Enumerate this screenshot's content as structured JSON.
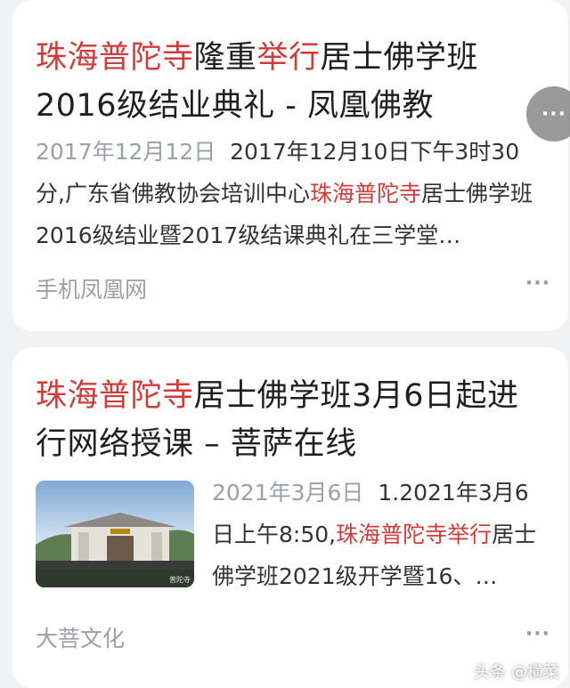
{
  "results": [
    {
      "title_parts": [
        {
          "text": "珠海普陀寺",
          "hl": true
        },
        {
          "text": "隆重",
          "hl": false
        },
        {
          "text": "举行",
          "hl": true
        },
        {
          "text": "居士佛学班2016级结业典礼 - 凤凰佛教",
          "hl": false
        }
      ],
      "date": "2017年12月12日",
      "snippet_parts": [
        {
          "text": "2017年12月10日下午3时30分,广东省佛教协会培训中心",
          "hl": false
        },
        {
          "text": "珠海普陀寺",
          "hl": true
        },
        {
          "text": "居士佛学班2016级结业暨2017级结课典礼在三学堂…",
          "hl": false
        }
      ],
      "source": "手机凤凰网",
      "more": "···"
    },
    {
      "title_parts": [
        {
          "text": "珠海普陀寺",
          "hl": true
        },
        {
          "text": "居士佛学班3月6日起进行网络授课 – 菩萨在线",
          "hl": false
        }
      ],
      "date": "2021年3月6日",
      "snippet_parts": [
        {
          "text": "1.2021年3月6日上午8:50,",
          "hl": false
        },
        {
          "text": "珠海普陀寺举行",
          "hl": true
        },
        {
          "text": "居士佛学班2021级开学暨16、…",
          "hl": false
        }
      ],
      "source": "大菩文化",
      "more": "···",
      "thumb_sign": "普陀寺"
    }
  ],
  "floating_more": "···",
  "watermark": "头条 @横菜",
  "colors": {
    "highlight": "#d33a3a",
    "text": "#1f1f1f",
    "muted": "#9aa0a6"
  }
}
